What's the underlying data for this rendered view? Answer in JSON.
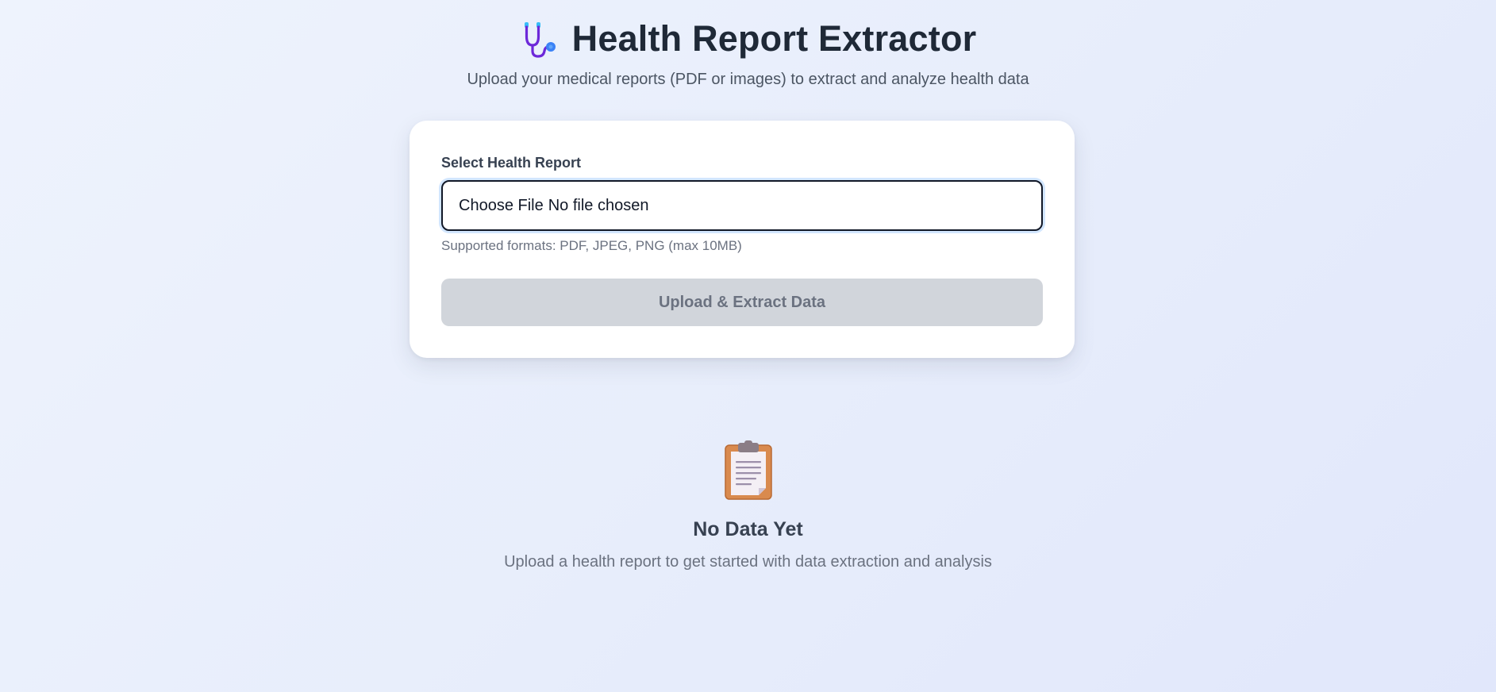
{
  "header": {
    "icon": "stethoscope-icon",
    "title": "Health Report Extractor",
    "subtitle": "Upload your medical reports (PDF or images) to extract and analyze health data"
  },
  "upload_card": {
    "label": "Select Health Report",
    "file_input": {
      "button_text": "Choose File",
      "status_text": "No file chosen"
    },
    "help_text": "Supported formats: PDF, JPEG, PNG (max 10MB)",
    "submit_label": "Upload & Extract Data"
  },
  "empty_state": {
    "icon": "clipboard-icon",
    "title": "No Data Yet",
    "description": "Upload a health report to get started with data extraction and analysis"
  },
  "colors": {
    "background": "#e8eefc",
    "title_text": "#1f2937",
    "disabled_button_bg": "#d1d5db",
    "disabled_button_text": "#6b7280",
    "input_border": "#111827"
  }
}
